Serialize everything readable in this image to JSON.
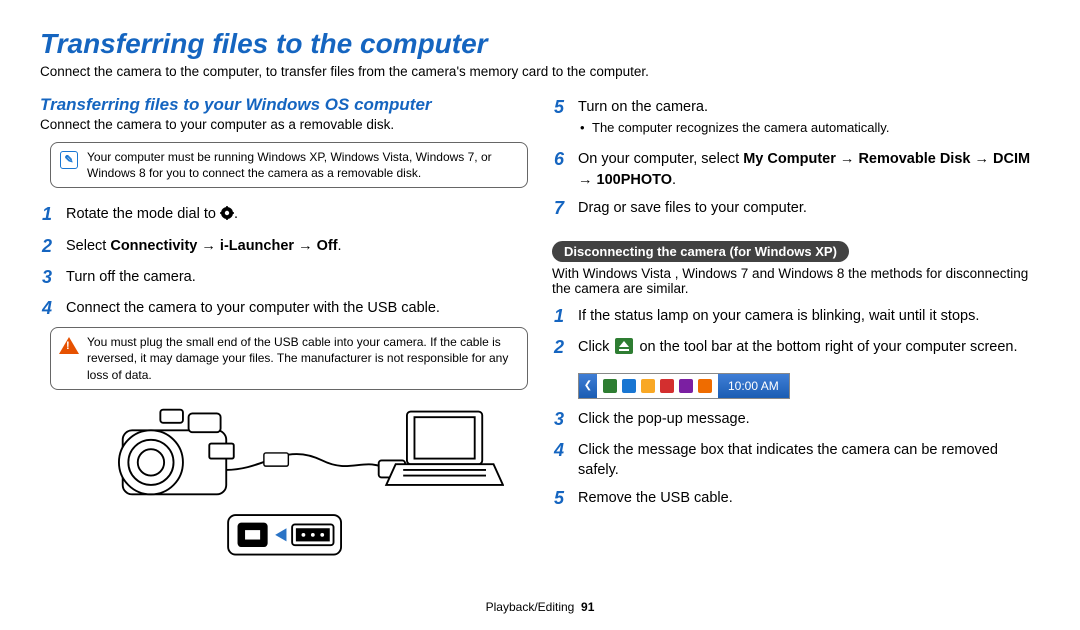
{
  "title": "Transferring files to the computer",
  "intro": "Connect the camera to the computer, to transfer files from the camera's memory card to the computer.",
  "left": {
    "heading": "Transferring files to your Windows OS computer",
    "sub": "Connect the camera to your computer as a removable disk.",
    "note": "Your computer must be running Windows XP, Windows Vista, Windows 7, or Windows 8 for you to connect the camera as a removable disk.",
    "steps": {
      "s1_pre": "Rotate the mode dial to ",
      "s1_post": ".",
      "s2_pre": "Select ",
      "s2_b1": "Connectivity",
      "s2_arrow": " → ",
      "s2_b2": "i-Launcher",
      "s2_b3": "Off",
      "s2_post": ".",
      "s3": "Turn off the camera.",
      "s4": "Connect the camera to your computer with the USB cable."
    },
    "warn": "You must plug the small end of the USB cable into your camera. If the cable is reversed, it may damage your files. The manufacturer is not responsible for any loss of data."
  },
  "right": {
    "s5": "Turn on the camera.",
    "s5_sub": "The computer recognizes the camera automatically.",
    "s6_pre": "On your computer, select ",
    "s6_b1": "My Computer",
    "s6_arrow": " → ",
    "s6_b2": "Removable Disk",
    "s6_b3": "DCIM",
    "s6_b4": "100PHOTO",
    "s6_post": ".",
    "s7": "Drag or save files to your computer.",
    "disconnect_heading": "Disconnecting the camera (for Windows XP)",
    "disconnect_sub": "With Windows Vista , Windows 7 and Windows 8 the methods for disconnecting the camera are similar.",
    "d1": "If the status lamp on your camera is blinking, wait until it stops.",
    "d2_pre": "Click ",
    "d2_post": " on the tool bar at the bottom right of your computer screen.",
    "clock": "10:00 AM",
    "d3": "Click the pop-up message.",
    "d4": "Click the message box that indicates the camera can be removed safely.",
    "d5": "Remove the USB cable."
  },
  "footer": {
    "section": "Playback/Editing",
    "page": "91"
  },
  "colors": {
    "accent": "#1565c0"
  }
}
